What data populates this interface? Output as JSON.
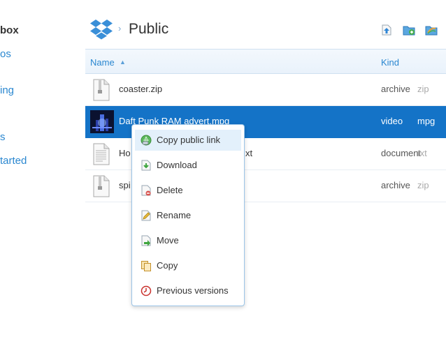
{
  "sidebar": {
    "items": [
      {
        "label": "box",
        "bold": true
      },
      {
        "label": "os"
      },
      {
        "label": "ing"
      },
      {
        "label": "s"
      },
      {
        "label": "tarted"
      }
    ]
  },
  "header": {
    "breadcrumb_separator": "›",
    "title": "Public",
    "icons": [
      "upload-icon",
      "new-folder-icon",
      "share-folder-icon"
    ]
  },
  "columns": {
    "name": "Name",
    "kind": "Kind",
    "sort_indicator": "▲"
  },
  "files": [
    {
      "name": "coaster.zip",
      "kind": "archive",
      "ext": "zip",
      "icon": "zip-file-icon",
      "selected": false
    },
    {
      "name": "Daft Punk RAM advert.mpg",
      "kind": "video",
      "ext": "mpg",
      "icon": "video-thumbnail",
      "selected": true
    },
    {
      "name": "Ho",
      "name_tail": "xt",
      "kind": "document",
      "ext": "txt",
      "icon": "text-file-icon",
      "selected": false
    },
    {
      "name": "spi",
      "kind": "archive",
      "ext": "zip",
      "icon": "zip-file-icon",
      "selected": false
    }
  ],
  "context_menu": {
    "items": [
      {
        "label": "Copy public link",
        "icon": "public-link-icon",
        "highlighted": true
      },
      {
        "label": "Download",
        "icon": "download-icon"
      },
      {
        "label": "Delete",
        "icon": "delete-icon"
      },
      {
        "label": "Rename",
        "icon": "rename-icon"
      },
      {
        "label": "Move",
        "icon": "move-icon"
      },
      {
        "label": "Copy",
        "icon": "copy-icon"
      },
      {
        "label": "Previous versions",
        "icon": "previous-versions-icon"
      }
    ]
  },
  "colors": {
    "accent": "#2a87d0",
    "selection": "#1473c7",
    "menu_highlight": "#e3f0fb"
  }
}
